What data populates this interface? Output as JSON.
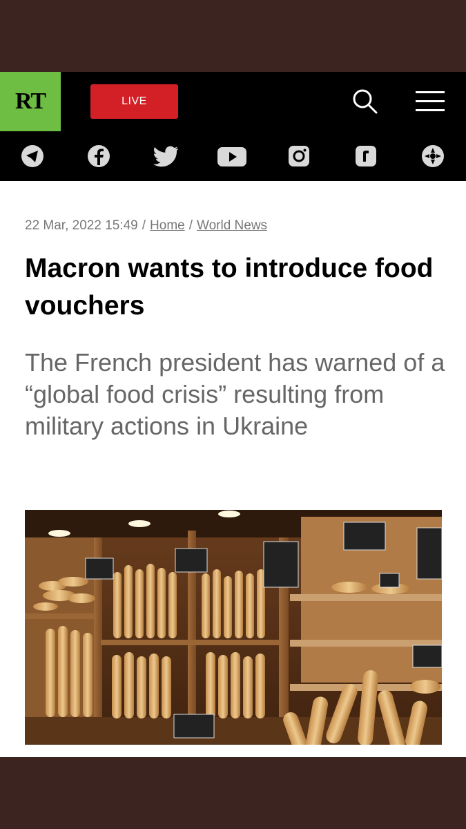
{
  "brand": {
    "logo_text": "RT",
    "accent": "#6fbe44"
  },
  "header": {
    "live_label": "LIVE",
    "live_color": "#d32026"
  },
  "social": [
    "telegram-icon",
    "facebook-icon",
    "twitter-icon",
    "youtube-icon",
    "instagram-icon",
    "rumble-icon",
    "vk-icon"
  ],
  "article": {
    "date": "22 Mar, 2022 15:49",
    "separator": "/",
    "breadcrumb": [
      "Home",
      "World News"
    ],
    "title": "Macron wants to introduce food vouchers",
    "subtitle": "The French president has warned of a “global food crisis” resulting from military actions in Ukraine"
  }
}
